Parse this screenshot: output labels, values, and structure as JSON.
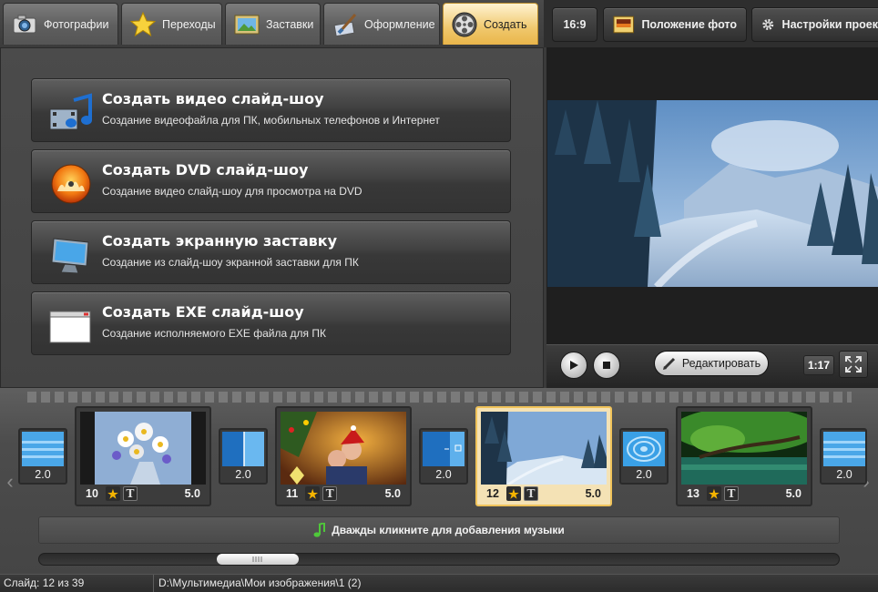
{
  "tabs": [
    {
      "label": "Фотографии",
      "icon": "photos-icon",
      "active": false
    },
    {
      "label": "Переходы",
      "icon": "star-icon",
      "active": false
    },
    {
      "label": "Заставки",
      "icon": "screensaver-picture-icon",
      "active": false
    },
    {
      "label": "Оформление",
      "icon": "paintbrush-icon",
      "active": false
    },
    {
      "label": "Создать",
      "icon": "film-reel-icon",
      "active": true
    }
  ],
  "toolbar": {
    "aspect_label": "16:9",
    "photo_position_label": "Положение фото",
    "project_settings_label": "Настройки проек"
  },
  "create_options": [
    {
      "title": "Создать видео слайд-шоу",
      "subtitle": "Создание видеофайла для ПК, мобильных телефонов и Интернет",
      "icon": "video-music-icon"
    },
    {
      "title": "Создать DVD слайд-шоу",
      "subtitle": "Создание видео слайд-шоу для просмотра на DVD",
      "icon": "dvd-disc-icon"
    },
    {
      "title": "Создать экранную заставку",
      "subtitle": "Создание из слайд-шоу экранной заставки для ПК",
      "icon": "monitor-icon"
    },
    {
      "title": "Создать EXE слайд-шоу",
      "subtitle": "Создание исполняемого EXE файла для ПК",
      "icon": "exe-window-icon"
    }
  ],
  "player": {
    "edit_label": "Редактировать",
    "time": "1:17"
  },
  "timeline": {
    "slides": [
      {
        "number": "10",
        "duration": "5.0",
        "selected": false,
        "image": "flowers"
      },
      {
        "number": "11",
        "duration": "5.0",
        "selected": false,
        "image": "christmas-kids"
      },
      {
        "number": "12",
        "duration": "5.0",
        "selected": true,
        "image": "snow-forest"
      },
      {
        "number": "13",
        "duration": "5.0",
        "selected": false,
        "image": "green-lake"
      }
    ],
    "transitions": [
      "2.0",
      "2.0",
      "2.0",
      "2.0",
      "2.0"
    ],
    "music_hint": "Дважды кликните для добавления музыки"
  },
  "status": {
    "slide_info": "Слайд: 12 из 39",
    "path": "D:\\Мультимедиа\\Мои изображения\\1 (2)"
  },
  "colors": {
    "active_tab": "#f0c86d",
    "background": "#3a3a3a",
    "selected_slide_border": "#f0c35a"
  }
}
